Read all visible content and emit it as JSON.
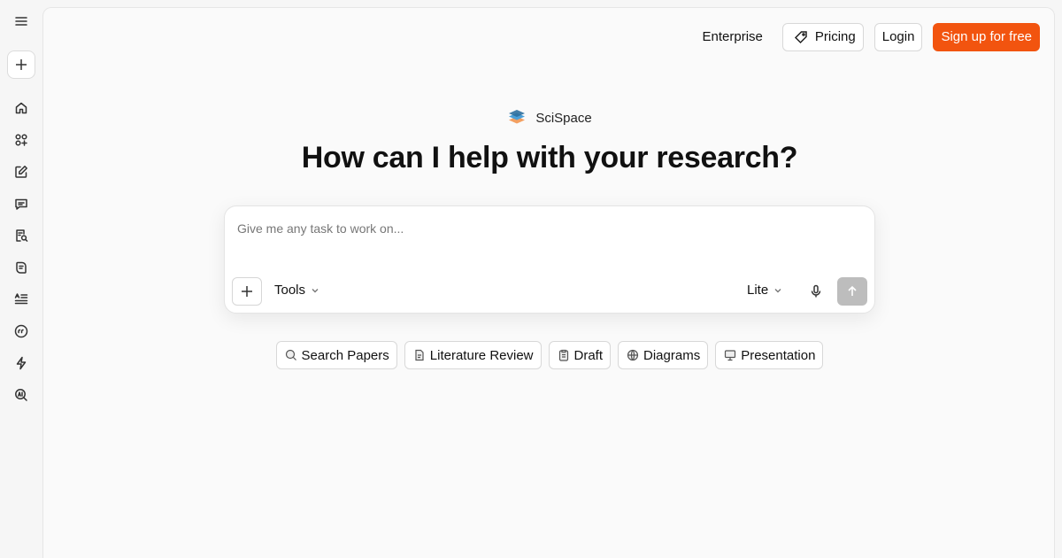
{
  "rail": {
    "items": [
      {
        "name": "home-icon"
      },
      {
        "name": "apps-icon"
      },
      {
        "name": "edit-icon"
      },
      {
        "name": "chat-icon"
      },
      {
        "name": "document-search-icon"
      },
      {
        "name": "pdf-icon"
      },
      {
        "name": "text-list-icon"
      },
      {
        "name": "quote-icon"
      },
      {
        "name": "lightning-icon"
      },
      {
        "name": "ai-detector-icon"
      }
    ]
  },
  "header": {
    "enterprise": "Enterprise",
    "pricing": "Pricing",
    "login": "Login",
    "signup": "Sign up for free"
  },
  "brand": {
    "name": "SciSpace"
  },
  "hero": {
    "title": "How can I help with your research?"
  },
  "prompt": {
    "placeholder": "Give me any task to work on...",
    "tools_label": "Tools",
    "mode_label": "Lite"
  },
  "chips": [
    {
      "label": "Search Papers",
      "icon": "search-icon"
    },
    {
      "label": "Literature Review",
      "icon": "document-icon"
    },
    {
      "label": "Draft",
      "icon": "clipboard-icon"
    },
    {
      "label": "Diagrams",
      "icon": "globe-icon"
    },
    {
      "label": "Presentation",
      "icon": "monitor-icon"
    }
  ],
  "colors": {
    "accent": "#f2540f",
    "background": "#fafafa",
    "send_disabled": "#bdbdbd"
  }
}
